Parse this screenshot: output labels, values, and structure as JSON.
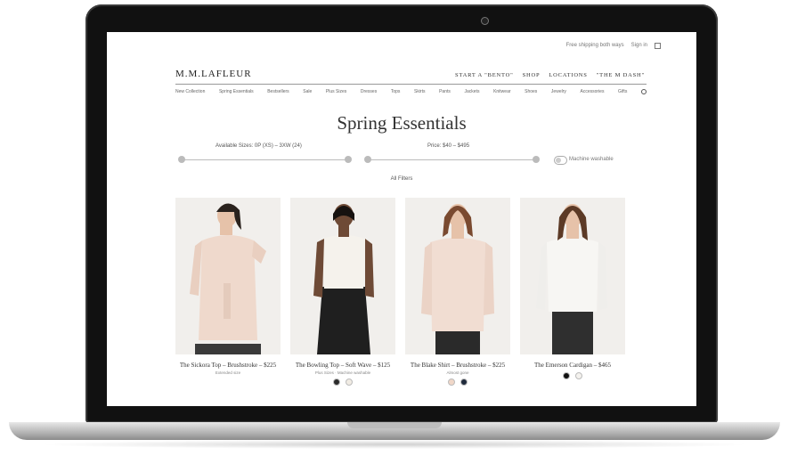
{
  "utility": {
    "shipping": "Free shipping both ways",
    "signin": "Sign in"
  },
  "brand": {
    "logo": "M.M.LAFLEUR"
  },
  "top_nav": [
    "START A \"BENTO\"",
    "SHOP",
    "LOCATIONS",
    "\"THE M DASH\""
  ],
  "category_nav": [
    "New Collection",
    "Spring Essentials",
    "Bestsellers",
    "Sale",
    "Plus Sizes",
    "Dresses",
    "Tops",
    "Skirts",
    "Pants",
    "Jackets",
    "Knitwear",
    "Shoes",
    "Jewelry",
    "Accessories",
    "Gifts"
  ],
  "page_title": "Spring Essentials",
  "filters": {
    "sizes_label": "Available Sizes: 0P (XS) – 3XW (24)",
    "sizes_level": [
      0,
      1
    ],
    "price_label": "Price: $40 – $495",
    "price_level": [
      0,
      1
    ],
    "toggle_label": "Machine washable",
    "all_filters": "All Filters"
  },
  "products": [
    {
      "name": "The Sickora Top – Brushstroke – $225",
      "sub": "Extended size",
      "swatches": []
    },
    {
      "name": "The Bowling Top – Soft Wave – $125",
      "sub": "Plus Sizes · Machine washable",
      "swatches": [
        "#2b2b2b",
        "#f1ece4"
      ]
    },
    {
      "name": "The Blake Shirt – Brushstroke – $225",
      "sub": "Almost gone",
      "swatches": [
        "#f0d7c8",
        "#1f2a3c"
      ]
    },
    {
      "name": "The Emerson Cardigan – $465",
      "sub": "",
      "swatches": [
        "#111111",
        "#f4f2ee"
      ]
    }
  ],
  "colors": {
    "accent": "#333333",
    "track": "#bbbbbb",
    "photo_bg": "#f1efec"
  }
}
